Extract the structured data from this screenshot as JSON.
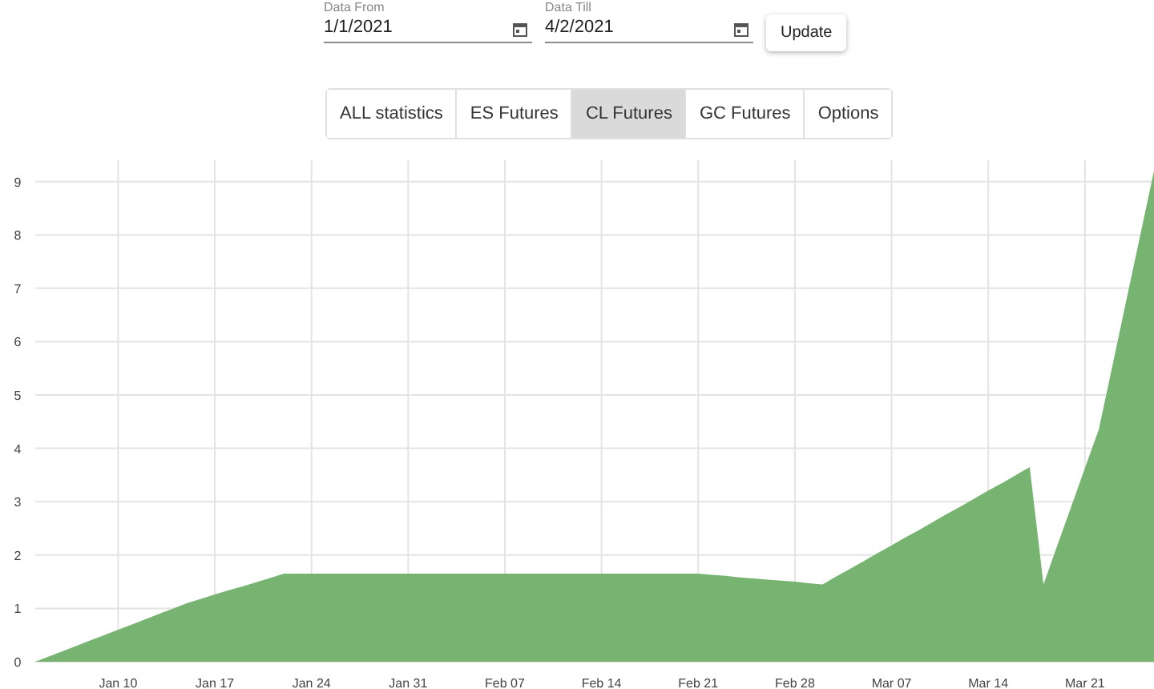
{
  "filters": {
    "date_from": {
      "label": "Data From",
      "value": "1/1/2021"
    },
    "date_till": {
      "label": "Data Till",
      "value": "4/2/2021"
    },
    "update_button": "Update"
  },
  "tabs": [
    {
      "label": "ALL statistics",
      "selected": false
    },
    {
      "label": "ES Futures",
      "selected": false
    },
    {
      "label": "CL Futures",
      "selected": true
    },
    {
      "label": "GC Futures",
      "selected": false
    },
    {
      "label": "Options",
      "selected": false
    }
  ],
  "chart": {
    "chart_data": {
      "type": "area",
      "categories": [
        null,
        null,
        null,
        null,
        null,
        null,
        "Jan 10",
        null,
        null,
        null,
        null,
        null,
        null,
        "Jan 17",
        null,
        null,
        null,
        null,
        null,
        null,
        "Jan 24",
        null,
        null,
        null,
        null,
        null,
        null,
        "Jan 31",
        null,
        null,
        null,
        null,
        null,
        null,
        "Feb 07",
        null,
        null,
        null,
        null,
        null,
        null,
        "Feb 14",
        null,
        null,
        null,
        null,
        null,
        null,
        "Feb 21",
        null,
        null,
        null,
        null,
        null,
        null,
        "Feb 28",
        null,
        null,
        null,
        null,
        null,
        null,
        "Mar 07",
        null,
        null,
        null,
        null,
        null,
        null,
        "Mar 14",
        null,
        null,
        null,
        null,
        null,
        null,
        "Mar 21",
        null,
        null,
        null,
        null,
        null
      ],
      "series": [
        {
          "color": "#77b371",
          "values": [
            0,
            0.1,
            0.2,
            0.3,
            0.4,
            0.5,
            0.6,
            0.7,
            0.8,
            0.9,
            1.0,
            1.1,
            1.18,
            1.26,
            1.34,
            1.41,
            1.49,
            1.57,
            1.65,
            1.65,
            1.65,
            1.65,
            1.65,
            1.65,
            1.65,
            1.65,
            1.65,
            1.65,
            1.65,
            1.65,
            1.65,
            1.65,
            1.65,
            1.65,
            1.65,
            1.65,
            1.65,
            1.65,
            1.65,
            1.65,
            1.65,
            1.65,
            1.65,
            1.65,
            1.65,
            1.65,
            1.65,
            1.65,
            1.65,
            1.63,
            1.61,
            1.58,
            1.56,
            1.54,
            1.52,
            1.5,
            1.47,
            1.45,
            1.6,
            1.74,
            1.89,
            2.04,
            2.18,
            2.33,
            2.47,
            2.62,
            2.77,
            2.91,
            3.06,
            3.21,
            3.35,
            3.5,
            3.65,
            1.45,
            2.18,
            2.9,
            3.63,
            4.35,
            5.56,
            6.78,
            7.99,
            9.2
          ]
        }
      ],
      "grid": true,
      "ylim": [
        0,
        9.4
      ],
      "yticks": [
        0,
        1,
        2,
        3,
        4,
        5,
        6,
        7,
        8,
        9
      ]
    }
  }
}
